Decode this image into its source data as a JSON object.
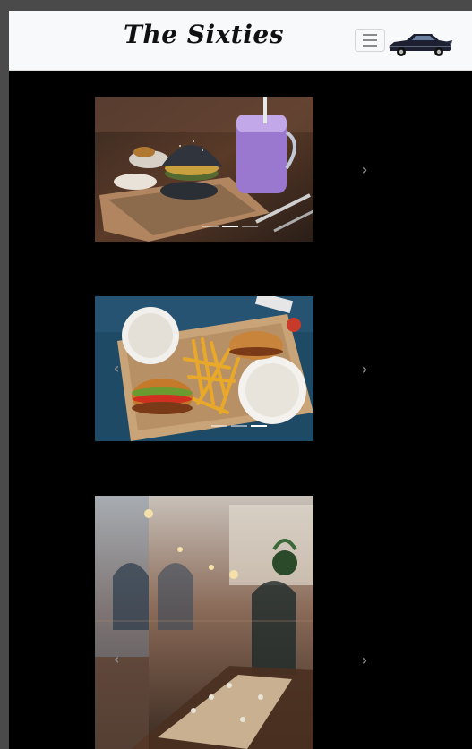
{
  "navbar": {
    "brand": "The Sixties",
    "toggle_icon": "hamburger-icon",
    "logo_icon": "classic-car-icon"
  },
  "carousels": [
    {
      "image": "burger-and-smoothie-photo",
      "indicator_count": 3,
      "active_index": 1,
      "next_glyph": "›",
      "prev_glyph": ""
    },
    {
      "image": "burgers-and-fries-photo",
      "indicator_count": 3,
      "active_index": 2,
      "next_glyph": "›",
      "prev_glyph": "‹"
    },
    {
      "image": "restaurant-interior-photo",
      "indicator_count": 0,
      "active_index": 0,
      "next_glyph": "›",
      "prev_glyph": "‹"
    }
  ],
  "colors": {
    "navbar_bg": "#f8f9fa",
    "page_bg": "#000000",
    "control": "#8e8e8e"
  }
}
